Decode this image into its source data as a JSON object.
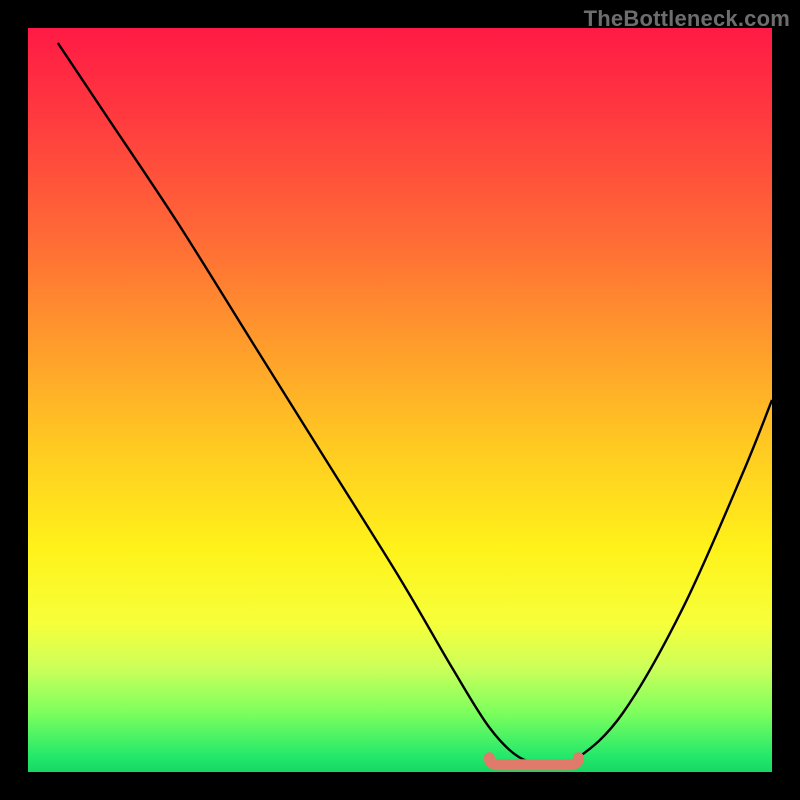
{
  "watermark": "TheBottleneck.com",
  "chart_data": {
    "type": "line",
    "title": "",
    "xlabel": "",
    "ylabel": "",
    "xlim": [
      0,
      100
    ],
    "ylim": [
      0,
      100
    ],
    "grid": false,
    "legend": false,
    "series": [
      {
        "name": "bottleneck-curve",
        "x": [
          4,
          10,
          20,
          30,
          40,
          50,
          57,
          62,
          66,
          70,
          74,
          80,
          88,
          96,
          100
        ],
        "y": [
          98,
          89,
          74,
          58,
          42,
          26,
          14,
          6,
          2,
          1,
          2,
          8,
          22,
          40,
          50
        ]
      }
    ],
    "annotations": [
      {
        "name": "optimal-band",
        "type": "segment",
        "x": [
          62,
          74
        ],
        "y": [
          1.5,
          1.5
        ],
        "color": "#e07a6a"
      }
    ]
  }
}
